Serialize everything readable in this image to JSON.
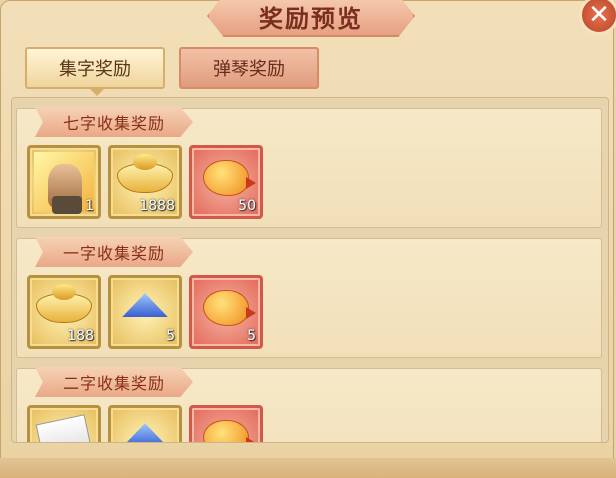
{
  "window": {
    "title": "奖励预览"
  },
  "close": {
    "label": "✕"
  },
  "tabs": [
    {
      "label": "集字奖励",
      "active": true
    },
    {
      "label": "弹琴奖励",
      "active": false
    }
  ],
  "sections": [
    {
      "title": "七字收集奖励",
      "items": [
        {
          "name": "hero-card",
          "count": "1"
        },
        {
          "name": "gold-ingot",
          "count": "1888"
        },
        {
          "name": "fire-bird",
          "count": "50"
        }
      ]
    },
    {
      "title": "一字收集奖励",
      "items": [
        {
          "name": "gold-ingot",
          "count": "188"
        },
        {
          "name": "blue-hat",
          "count": "5"
        },
        {
          "name": "fire-bird",
          "count": "5"
        }
      ]
    },
    {
      "title": "二字收集奖励",
      "items": [
        {
          "name": "scroll",
          "count": ""
        },
        {
          "name": "blue-hat",
          "count": ""
        },
        {
          "name": "fire-bird",
          "count": ""
        }
      ]
    }
  ],
  "colors": {
    "accent": "#e09c7e",
    "title_text": "#7a2e1e",
    "gold_frame": "#b8913e",
    "red_frame": "#d2584a"
  }
}
